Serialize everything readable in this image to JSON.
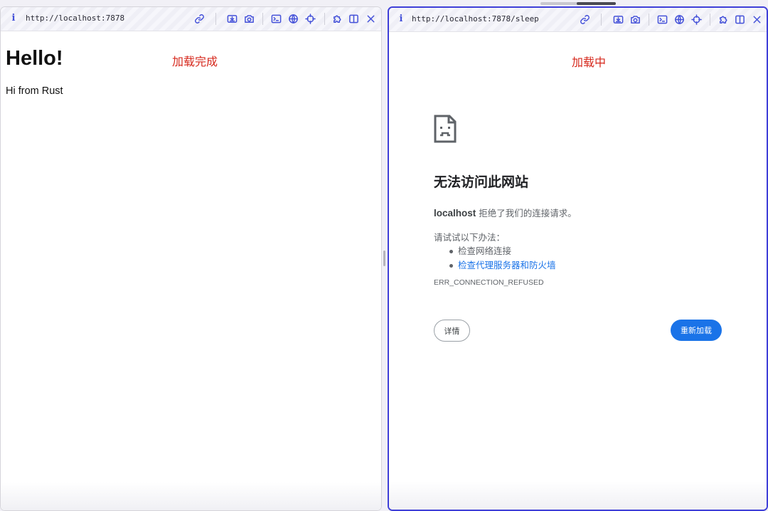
{
  "left_pane": {
    "url": "http://localhost:7878",
    "status_label": "加载完成",
    "content": {
      "heading": "Hello!",
      "paragraph": "Hi from Rust"
    }
  },
  "right_pane": {
    "url": "http://localhost:7878/sleep",
    "status_label": "加载中",
    "error_page": {
      "title": "无法访问此网站",
      "host": "localhost",
      "desc_rest": " 拒绝了我们的连接请求。",
      "try_heading": "请试试以下办法：",
      "suggestions": [
        {
          "text": "检查网络连接",
          "is_link": false
        },
        {
          "text": "检查代理服务器和防火墙",
          "is_link": true
        }
      ],
      "error_code": "ERR_CONNECTION_REFUSED",
      "details_button": "详情",
      "reload_button": "重新加载"
    }
  },
  "toolbar_icons": [
    "info-icon",
    "link-icon",
    "download-icon",
    "camera-icon",
    "terminal-icon",
    "globe-icon",
    "crosshair-icon",
    "puzzle-icon",
    "split-icon",
    "close-icon"
  ],
  "colors": {
    "accent": "#4552d9",
    "active_border": "#3f3fd8",
    "status_red": "#d6281c",
    "link_blue": "#1a73e8"
  }
}
